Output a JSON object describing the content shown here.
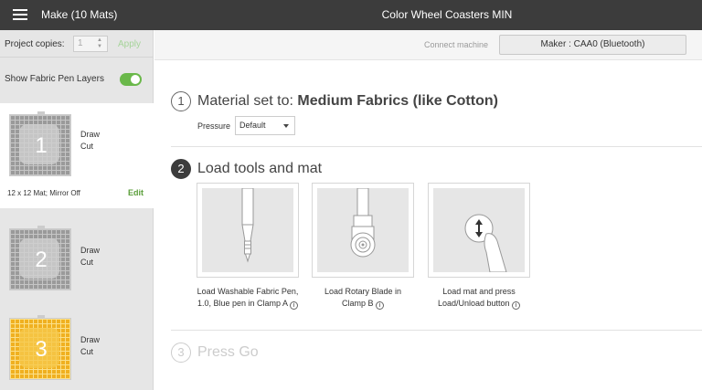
{
  "topbar": {
    "app_title": "Make (10 Mats)",
    "project_title": "Color Wheel Coasters MIN"
  },
  "sidebar": {
    "copies_label": "Project copies:",
    "copies_value": "1",
    "apply_label": "Apply",
    "fabric_label": "Show Fabric Pen Layers",
    "fabric_toggle_on": true,
    "mats": [
      {
        "number": "1",
        "op1": "Draw",
        "op2": "Cut",
        "info": "12 x 12 Mat; Mirror Off",
        "edit": "Edit"
      },
      {
        "number": "2",
        "op1": "Draw",
        "op2": "Cut"
      },
      {
        "number": "3",
        "op1": "Draw",
        "op2": "Cut"
      }
    ]
  },
  "connect": {
    "label": "Connect machine",
    "maker": "Maker : CAA0 (Bluetooth)"
  },
  "steps": {
    "s1": {
      "num": "1",
      "prefix": "Material set to: ",
      "material": "Medium Fabrics (like Cotton)"
    },
    "pressure": {
      "label": "Pressure",
      "value": "Default"
    },
    "s2": {
      "num": "2",
      "title": "Load tools and mat"
    },
    "s3": {
      "num": "3",
      "title": "Press Go"
    }
  },
  "tools": [
    {
      "caption": "Load Washable Fabric Pen, 1.0, Blue pen in Clamp A"
    },
    {
      "caption": "Load Rotary Blade in Clamp B"
    },
    {
      "caption": "Load mat and press Load/Unload button"
    }
  ],
  "info_glyph": "i",
  "colors": {
    "topbar": "#3c3c3c",
    "accent_green": "#6ab84a",
    "mat_yellow": "#f0b020"
  }
}
